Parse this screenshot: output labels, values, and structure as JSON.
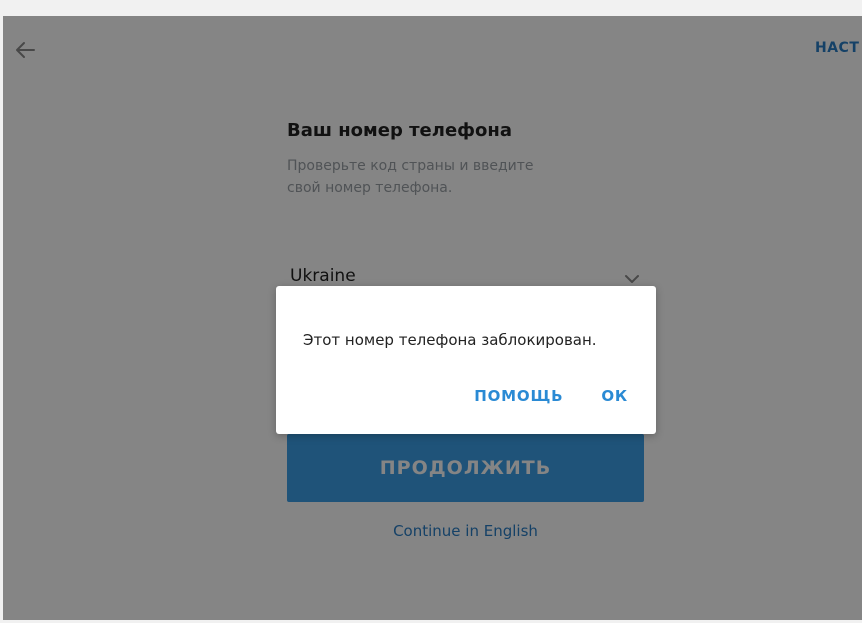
{
  "header": {
    "back_icon": "arrow-left-icon",
    "settings_label": "НАСТ"
  },
  "login": {
    "title": "Ваш номер телефона",
    "subtitle": "Проверьте код страны и введите свой номер телефона.",
    "country": "Ukraine",
    "country_icon": "chevron-down-icon",
    "continue_label": "ПРОДОЛЖИТЬ",
    "english_link": "Continue in English"
  },
  "dialog": {
    "message": "Этот номер телефона заблокирован.",
    "help_label": "ПОМОЩЬ",
    "ok_label": "ОК"
  },
  "colors": {
    "accent": "#2a8ad4",
    "button": "#3d9fe8",
    "overlay": "rgba(0,0,0,0.48)"
  }
}
